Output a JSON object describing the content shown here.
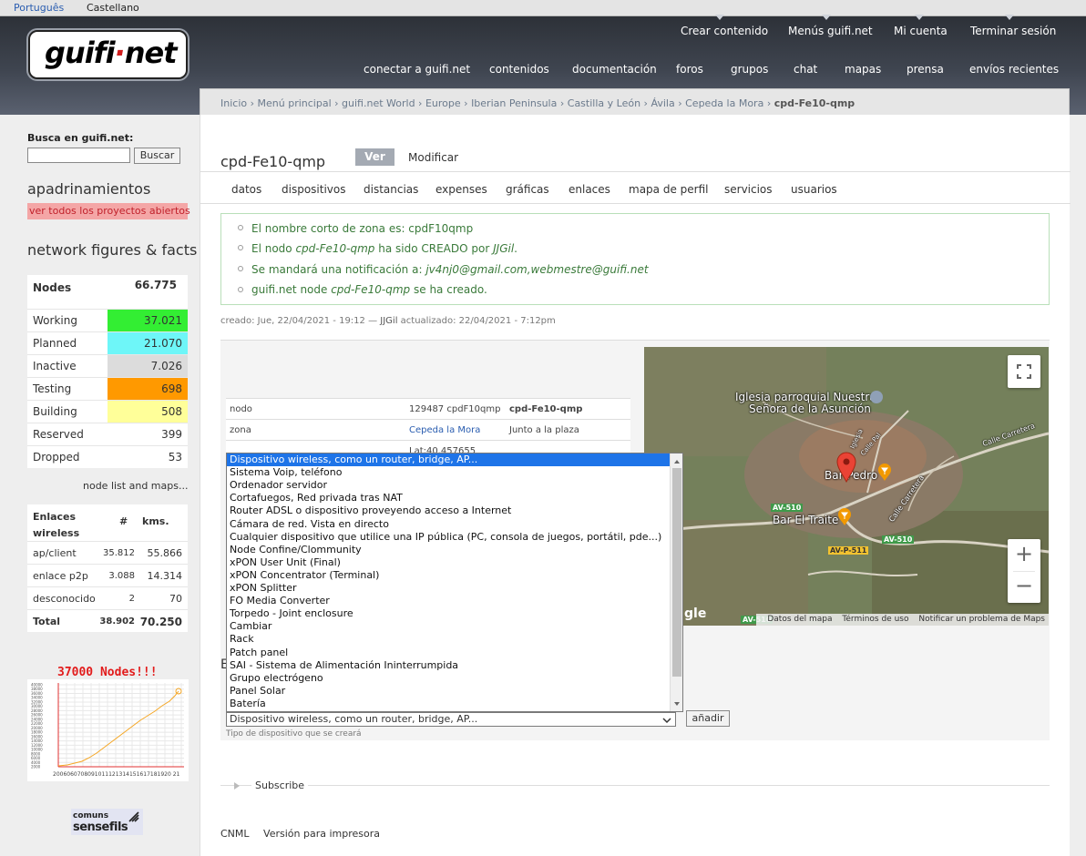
{
  "language_bar": {
    "lang_pt": "Português",
    "lang_es": "Castellano"
  },
  "header": {
    "logo_text_a": "guifi",
    "logo_text_dot": "·",
    "logo_text_b": "net",
    "primary_links": [
      "Crear contenido",
      "Menús guifi.net",
      "Mi cuenta",
      "Terminar sesión"
    ],
    "secondary_links": [
      "conectar a guifi.net",
      "contenidos",
      "documentación",
      "foros",
      "grupos",
      "chat",
      "mapas",
      "prensa",
      "envíos recientes"
    ]
  },
  "breadcrumb": {
    "items": [
      "Inicio",
      "Menú principal",
      "guifi.net World",
      "Europe",
      "Iberian Peninsula",
      "Castilla y León",
      "Ávila",
      "Cepeda la Mora"
    ],
    "separator": " › ",
    "current": "cpd-Fe10-qmp"
  },
  "sidebar": {
    "search_title": "Busca en guifi.net:",
    "search_value": "",
    "search_button": "Buscar",
    "sponsor_heading": "apadrinamientos",
    "sponsor_link": "ver todos los proyectos abiertos",
    "figures_heading": "network figures & facts",
    "nodes_label": "Nodes",
    "nodes_value": "66.775",
    "node_stats": [
      {
        "label": "Working",
        "value": "37.021",
        "color": "#33ee33"
      },
      {
        "label": "Planned",
        "value": "21.070",
        "color": "#6ef6f8"
      },
      {
        "label": "Inactive",
        "value": "7.026",
        "color": "#dcdcdc"
      },
      {
        "label": "Testing",
        "value": "698",
        "color": "#ff9900"
      },
      {
        "label": "Building",
        "value": "508",
        "color": "#ffff99"
      },
      {
        "label": "Reserved",
        "value": "399",
        "color": "#ffffff"
      },
      {
        "label": "Dropped",
        "value": "53",
        "color": "#ffffff"
      }
    ],
    "node_list_link": "node list and maps...",
    "links_header": {
      "c1": "Enlaces wireless",
      "c2": "#",
      "c3": "kms."
    },
    "links_rows": [
      {
        "c1": "ap/client",
        "c2": "35.812",
        "c3": "55.866"
      },
      {
        "c1": "enlace p2p",
        "c2": "3.088",
        "c3": "14.314"
      },
      {
        "c1": "desconocido",
        "c2": "2",
        "c3": "70"
      },
      {
        "c1": "Total",
        "c2": "38.902",
        "c3": "70.250"
      }
    ],
    "graph_title": "37000 Nodes!!!",
    "graph_xlabels": "2006060708091011121314151617181920 21",
    "graph_ylabels": [
      "40000",
      "38000",
      "36000",
      "34000",
      "32000",
      "30000",
      "28000",
      "26000",
      "24000",
      "22000",
      "20000",
      "18000",
      "16000",
      "14000",
      "12000",
      "10000",
      "8000",
      "6000",
      "4000",
      "2000"
    ],
    "partner_logo_line1": "comuns",
    "partner_logo_line2": "sensefils"
  },
  "main": {
    "title": "cpd-Fe10-qmp",
    "tab_view": "Ver",
    "tab_edit": "Modificar",
    "subtabs": [
      "datos",
      "dispositivos",
      "distancias",
      "expenses",
      "gráficas",
      "enlaces",
      "mapa de perfil",
      "servicios",
      "usuarios"
    ],
    "messages": [
      {
        "pre": "El nombre corto de zona es: cpdF10qmp",
        "em": "",
        "post": ""
      },
      {
        "pre": "El nodo ",
        "em": "cpd-Fe10-qmp",
        "post": " ha sido CREADO por ",
        "em2": "JJGil",
        "post2": "."
      },
      {
        "pre": "Se mandará una notificación a: ",
        "em": "jv4nj0@gmail.com,webmestre@guifi.net",
        "post": ""
      },
      {
        "pre": "guifi.net node ",
        "em": "cpd-Fe10-qmp",
        "post": " se ha creado."
      }
    ],
    "meta_created": "creado: Jue, 22/04/2021 - 19:12 — ",
    "meta_author": "JJGil",
    "meta_updated": " actualizado: 22/04/2021 - 7:12pm",
    "info_rows": [
      {
        "k": "nodo",
        "v1": "129487 cpdF10qmp",
        "v2": "cpd-Fe10-qmp"
      },
      {
        "k": "zona",
        "v1": "Cepeda la Mora",
        "v2": "Junto a la plaza"
      },
      {
        "k": "",
        "v1": "Lat:40.457655",
        "v2": ""
      }
    ],
    "map": {
      "church_label_1": "Iglesia parroquial Nuestra",
      "church_label_2": "Señora de la Asunción",
      "bar1": "Bar Pedro",
      "bar2": "Bar El Traite",
      "road1": "AV-510",
      "road2": "AV-510",
      "road3": "AV-P-511",
      "road4": "AV-510",
      "street1": "Calle Carretera",
      "street2": "Calle Carretera",
      "street3": "Calle Pal",
      "street4": "Iglesia",
      "google": "gle",
      "footer": [
        "Datos del mapa",
        "Términos de uso",
        "Notificar un problema de Maps"
      ],
      "zoom_in": "+",
      "zoom_out": "−"
    },
    "device_options": [
      "Dispositivo wireless, como un router, bridge, AP...",
      "Sistema Voip, teléfono",
      "Ordenador servidor",
      "Cortafuegos, Red privada tras NAT",
      "Router ADSL o dispositivo proveyendo acceso a Internet",
      "Cámara de red. Vista en directo",
      "Cualquier dispositivo que utilice una IP pública (PC, consola de juegos, portátil, pde...)",
      "Node Confine/Clommunity",
      "xPON User Unit (Final)",
      "xPON Concentrator (Terminal)",
      "xPON Splitter",
      "FO Media Converter",
      "Torpedo - Joint enclosure",
      "Cambiar",
      "Rack",
      "Patch panel",
      "SAI - Sistema de Alimentación Ininterrumpida",
      "Grupo electrógeno",
      "Panel Solar",
      "Batería"
    ],
    "selected_device": "Dispositivo wireless, como un router, bridge, AP...",
    "hidden_heading_fragment": "E",
    "add_button": "añadir",
    "help_text": "Tipo de dispositivo que se creará",
    "subscribe": "Subscribe",
    "footer_links": [
      "CNML",
      "Versión para impresora"
    ]
  }
}
